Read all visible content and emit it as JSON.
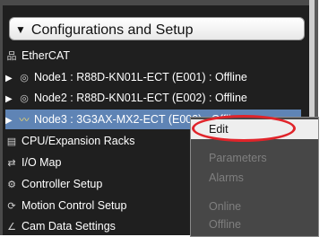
{
  "header": {
    "label": "Configurations and Setup",
    "toggle_icon": "triangle-down-icon"
  },
  "tree": [
    {
      "label": "EtherCAT",
      "icon": "network-icon"
    },
    {
      "label": "Node1 : R88D-KN01L-ECT (E001) : Offline",
      "icon": "device-icon"
    },
    {
      "label": "Node2 : R88D-KN01L-ECT (E002) : Offline",
      "icon": "device-icon"
    },
    {
      "label": "Node3 : 3G3AX-MX2-ECT (E003) : Offline",
      "icon": "inverter-icon"
    },
    {
      "label": "CPU/Expansion Racks",
      "icon": "rack-icon"
    },
    {
      "label": "I/O Map",
      "icon": "io-map-icon"
    },
    {
      "label": "Controller Setup",
      "icon": "controller-icon"
    },
    {
      "label": "Motion Control Setup",
      "icon": "motion-icon"
    },
    {
      "label": "Cam Data Settings",
      "icon": "cam-icon"
    }
  ],
  "context_menu": {
    "items": [
      {
        "label": "Edit",
        "enabled": true
      },
      {
        "label": "Parameters",
        "enabled": false
      },
      {
        "label": "Alarms",
        "enabled": false
      },
      {
        "label": "Online",
        "enabled": false
      },
      {
        "label": "Offline",
        "enabled": false
      }
    ]
  },
  "colors": {
    "selection": "#5f84b5",
    "highlight_oval": "#e0242a",
    "panel": "#1f1f1f"
  }
}
